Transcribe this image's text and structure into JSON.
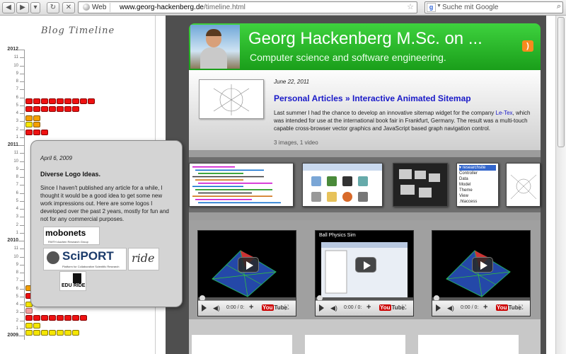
{
  "browser": {
    "web_label": "Web",
    "url_domain": "www.georg-hackenberg.de",
    "url_path": "/timeline.html",
    "search_placeholder": "Suche mit Google"
  },
  "timeline": {
    "title": "Blog Timeline",
    "years": [
      "2012",
      "2011",
      "2010",
      "2009"
    ],
    "month_labels": [
      "11",
      "10",
      "9",
      "8",
      "7",
      "6",
      "5",
      "4",
      "3",
      "2",
      "1"
    ]
  },
  "popup": {
    "date": "April 6, 2009",
    "title": "Diverse Logo Ideas.",
    "text": "Since I haven't published any article for a while, I thought it would be a good idea to get some new work impressions out. Here are some logos I developed over the past 2 years, mostly for fun and not for any commercial purposes.",
    "logo_moby": "mobonets",
    "logo_moby_sub": "RWTH Aachen Research Group",
    "logo_sciport": "SciPORT",
    "logo_sciport_sub": "Platform for Collaborative Scientific Research",
    "logo_ride": "ride",
    "logo_edu": "EDU RIDE"
  },
  "header": {
    "name": "Georg Hackenberg M.Sc. on ...",
    "tagline": "Computer science and software engineering."
  },
  "article": {
    "date": "June 22, 2011",
    "category": "Personal Articles",
    "separator": "»",
    "title": "Interactive Animated Sitemap",
    "text_before": "Last summer I had the chance to develop an innovative sitemap widget for the company ",
    "link": "Le-Tex",
    "text_after": ", which was intended for use at the international book fair in Frankfurt, Germany. The result was a multi-touch capable cross-browser vector graphics and JavaScript based graph navigation control.",
    "meta": "3 images, 1 video"
  },
  "tree_items": [
    "researchsite",
    "Controller",
    "Data",
    "Model",
    "Theme",
    "View",
    ".htaccess"
  ],
  "videos": [
    {
      "title": "",
      "time": "0:00 / 0:"
    },
    {
      "title": "Ball Physics Sim",
      "time": "0:00 / 0:"
    },
    {
      "title": "",
      "time": "0:00 / 0:"
    }
  ],
  "youtube_label": "You",
  "youtube_tube": "Tube",
  "colors": {
    "header_green": "#2fbf2f",
    "link_blue": "#1919c8",
    "timeline_red": "#ee1111",
    "timeline_yellow": "#f5e600",
    "timeline_orange": "#f5a000"
  }
}
